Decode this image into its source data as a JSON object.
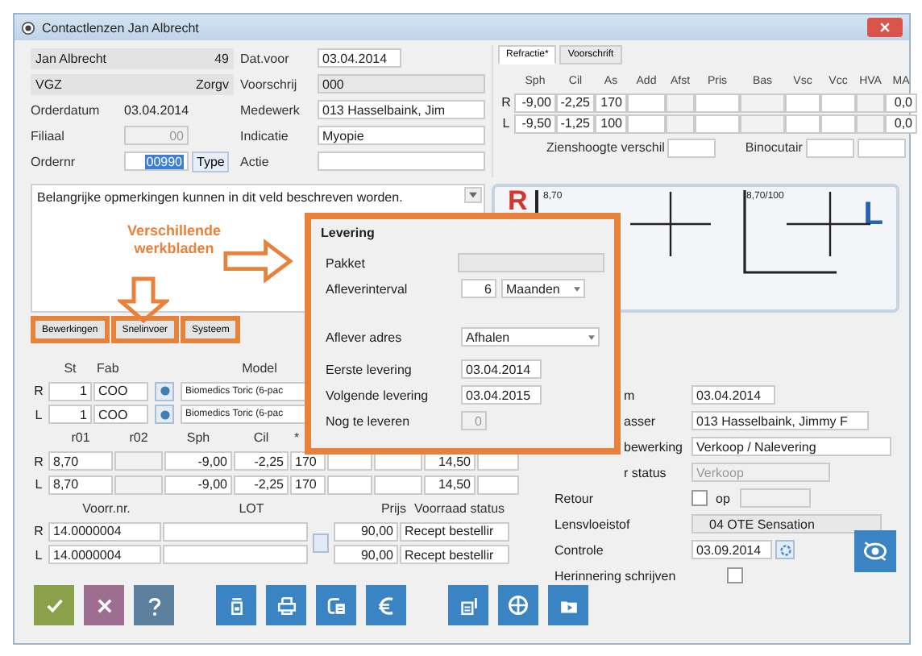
{
  "window": {
    "title": "Contactlenzen Jan Albrecht"
  },
  "client": {
    "name": "Jan Albrecht",
    "age": "49",
    "insurer": "VGZ",
    "insurer_cut": "Zorgv",
    "order_date_label": "Orderdatum",
    "order_date": "03.04.2014",
    "branch_label": "Filiaal",
    "branch": "00",
    "order_no_label": "Ordernr",
    "order_no": "00990",
    "order_no_selected": true,
    "type_button": "Type"
  },
  "prescription": [
    {
      "label": "Dat.voor",
      "value": "03.04.2014",
      "kind": "date"
    },
    {
      "label": "Voorschrij",
      "value": "000",
      "kind": "readonly"
    },
    {
      "label": "Medewerk",
      "value": "013 Hasselbaink, Jim",
      "kind": "field"
    },
    {
      "label": "Indicatie",
      "value": "Myopie",
      "kind": "field"
    },
    {
      "label": "Actie",
      "kind": "field"
    }
  ],
  "refraction": {
    "tabs": [
      {
        "label": "Refractie*",
        "selected": true
      },
      {
        "label": "Voorschrift",
        "selected": false
      }
    ],
    "columns": [
      "Sph",
      "Cil",
      "As",
      "Add",
      "Afst",
      "Pris",
      "Bas",
      "Vsc",
      "Vcc",
      "HVA",
      "MA"
    ],
    "rows": [
      {
        "eye": "R",
        "sph": "-9,00",
        "cil": "-2,25",
        "as": "170",
        "ma": "0,0"
      },
      {
        "eye": "L",
        "sph": "-9,50",
        "cil": "-1,25",
        "as": "100",
        "ma": "0,0"
      }
    ],
    "height_diff_label": "Zienshoogte verschil",
    "binocular_label": "Binocutair"
  },
  "remarks": {
    "text": "Belangrijke opmerkingen kunnen in dit veld beschreven worden."
  },
  "drawing": {
    "right_eye": "R",
    "right_value": "8,70",
    "left_value": "8,70/100",
    "left_eye": "L"
  },
  "annotation": {
    "text": "Verschillende werkbladen"
  },
  "worksheet_tabs": [
    {
      "label": "Bewerkingen",
      "selected": false
    },
    {
      "label": "Snelinvoer",
      "selected": false
    },
    {
      "label": "Systeem",
      "selected": false
    }
  ],
  "lenses": {
    "header": [
      "St",
      "Fab",
      "Model"
    ],
    "rows": [
      {
        "eye": "R",
        "count": "1",
        "maker": "COO",
        "model": "Biomedics Toric (6-pac"
      },
      {
        "eye": "L",
        "count": "1",
        "maker": "COO",
        "model": "Biomedics Toric (6-pac"
      }
    ]
  },
  "params": {
    "header": [
      "r01",
      "r02",
      "Sph",
      "Cil",
      "*"
    ],
    "rows": [
      {
        "eye": "R",
        "r01": "8,70",
        "sph": "-9,00",
        "cil": "-2,25",
        "axis": "170",
        "column_8": "14,50"
      },
      {
        "eye": "L",
        "r01": "8,70",
        "sph": "-9,00",
        "cil": "-2,25",
        "axis": "170",
        "column_8": "14,50"
      }
    ]
  },
  "stock": {
    "header": [
      "Voorr.nr.",
      "LOT",
      "Prijs",
      "Voorraad status"
    ],
    "rows": [
      {
        "eye": "R",
        "number": "14.0000004",
        "price": "90,00",
        "status": "Recept bestellir"
      },
      {
        "eye": "L",
        "number": "14.0000004",
        "price": "90,00",
        "status": "Recept bestellir"
      }
    ]
  },
  "details": [
    {
      "label": "m",
      "covered": true,
      "kind": "date",
      "value": "03.04.2014"
    },
    {
      "label": "asser",
      "covered": true,
      "kind": "field",
      "value": "013 Hasselbaink, Jimmy F"
    },
    {
      "label": "bewerking",
      "covered": true,
      "kind": "wide",
      "value": "Verkoop / Nalevering"
    },
    {
      "label": "r status",
      "covered": true,
      "kind": "disabled",
      "value": "Verkoop"
    },
    {
      "label": "Retour",
      "covered": false,
      "kind": "return",
      "checked": false,
      "option": "op"
    },
    {
      "label": "Lensvloeistof",
      "covered": false,
      "kind": "readonly",
      "value": "04 OTE Sensation"
    },
    {
      "label": "Controle",
      "covered": false,
      "kind": "datepicker",
      "value": "03.09.2014"
    },
    {
      "label": "Herinnering schrijven",
      "covered": false,
      "kind": "checkbox",
      "checked": false
    }
  ],
  "delivery": {
    "title": "Levering",
    "package_label": "Pakket",
    "interval_label": "Afleverinterval",
    "interval": "6",
    "interval_unit": "Maanden",
    "address_label": "Aflever adres",
    "address": "Afhalen",
    "first_label": "Eerste levering",
    "first": "03.04.2014",
    "next_label": "Volgende levering",
    "next": "03.04.2015",
    "remaining_label": "Nog te leveren",
    "remaining": "0"
  }
}
